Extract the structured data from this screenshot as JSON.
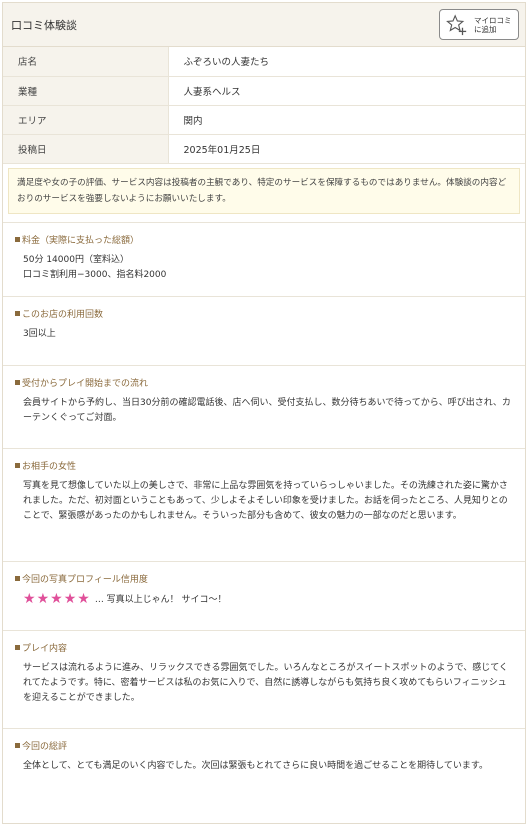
{
  "header": {
    "title": "口コミ体験談",
    "mykuchikomi_label_line1": "マイロコミ",
    "mykuchikomi_label_line2": "に追加"
  },
  "info_rows": [
    {
      "label": "店名",
      "value": "ふぞろいの人妻たち"
    },
    {
      "label": "業種",
      "value": "人妻系ヘルス"
    },
    {
      "label": "エリア",
      "value": "関内"
    },
    {
      "label": "投稿日",
      "value": "2025年01月25日"
    }
  ],
  "notice": "満足度や女の子の評価、サービス内容は投稿者の主観であり、特定のサービスを保障するものではありません。体験談の内容どおりのサービスを強要しないようにお願いいたします。",
  "sections": {
    "price": {
      "title": "料金（実際に支払った総額）",
      "line1": "50分 14000円（室料込）",
      "line2": "口コミ割利用−3000、指名料2000"
    },
    "visits": {
      "title": "このお店の利用回数",
      "body": "3回以上"
    },
    "flow": {
      "title": "受付からプレイ開始までの流れ",
      "body": "会員サイトから予約し、当日30分前の確認電話後、店へ伺い、受付支払し、数分待ちあいで待ってから、呼び出され、カーテンくぐってご対面。"
    },
    "partner": {
      "title": "お相手の女性",
      "body": "写真を見て想像していた以上の美しさで、非常に上品な雰囲気を持っていらっしゃいました。その洗練された姿に驚かされました。ただ、初対面ということもあって、少しよそよそしい印象を受けました。お話を伺ったところ、人見知りとのことで、緊張感があったのかもしれません。そういった部分も含めて、彼女の魅力の一部なのだと思います。"
    },
    "photo": {
      "title": "今回の写真プロフィール信用度",
      "rating": 5,
      "star_color": "#e0509a",
      "comment": "… 写真以上じゃん！ サイコ〜！"
    },
    "play": {
      "title": "プレイ内容",
      "body": "サービスは流れるように進み、リラックスできる雰囲気でした。いろんなところがスイートスポットのようで、感じてくれてたようです。特に、密着サービスは私のお気に入りで、自然に誘導しながらも気持ち良く攻めてもらいフィニッシュを迎えることができました。"
    },
    "summary": {
      "title": "今回の総評",
      "body": "全体として、とても満足のいく内容でした。次回は緊張もとれてさらに良い時間を過ごせることを期待しています。"
    }
  }
}
